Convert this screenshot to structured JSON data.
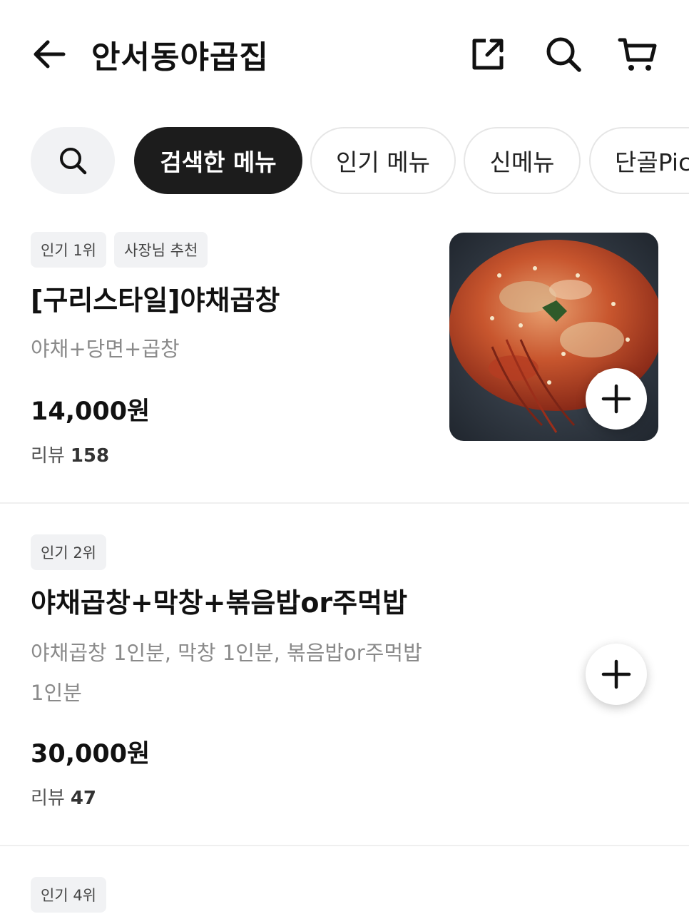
{
  "header": {
    "title": "안서동야곱집",
    "back_icon": "arrow-left-icon",
    "share_icon": "share-icon",
    "search_icon": "search-icon",
    "cart_icon": "cart-icon"
  },
  "chips": {
    "search_icon": "search-icon",
    "items": [
      {
        "label": "검색한 메뉴",
        "active": true
      },
      {
        "label": "인기 메뉴",
        "active": false
      },
      {
        "label": "신메뉴",
        "active": false
      },
      {
        "label": "단골Pick",
        "active": false
      }
    ]
  },
  "menu": [
    {
      "badges": [
        "인기 1위",
        "사장님 추천"
      ],
      "name": "[구리스타일]야채곱창",
      "description": [
        "야채+당면+곱창"
      ],
      "price": "14,000원",
      "review_label": "리뷰",
      "review_count": "158",
      "has_image": true
    },
    {
      "badges": [
        "인기 2위"
      ],
      "name": "야채곱창+막창+볶음밥or주먹밥",
      "description": [
        "야채곱창 1인분, 막창 1인분, 볶음밥or주먹밥",
        "1인분"
      ],
      "price": "30,000원",
      "review_label": "리뷰",
      "review_count": "47",
      "has_image": false
    },
    {
      "badges": [
        "인기 4위"
      ]
    }
  ],
  "colors": {
    "active_chip_bg": "#1c1c1c",
    "badge_bg": "#f1f2f4",
    "desc_text": "#8a8a8a"
  }
}
